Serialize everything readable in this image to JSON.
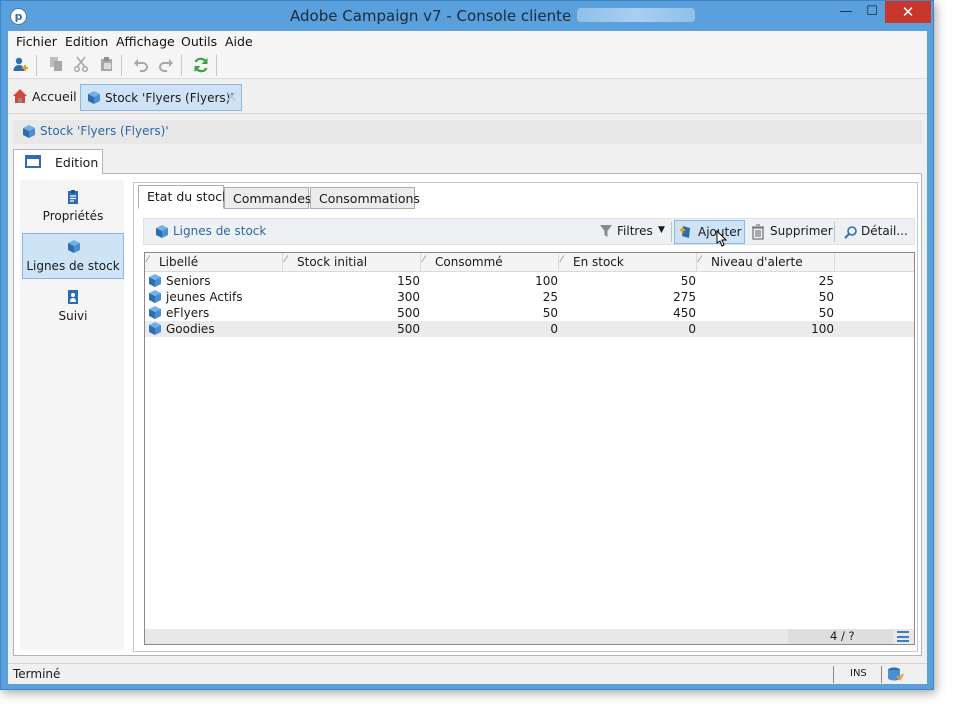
{
  "window": {
    "title": "Adobe Campaign v7 - Console cliente",
    "app_icon_glyph": "p",
    "minimize_glyph": "—",
    "maximize_glyph": "☐",
    "close_glyph": "✕"
  },
  "menu": {
    "items": [
      "Fichier",
      "Edition",
      "Affichage",
      "Outils",
      "Aide"
    ]
  },
  "toolbar": {
    "icons": [
      "add-user-icon",
      "copy-icon",
      "cut-icon",
      "paste-icon",
      "undo-icon",
      "redo-icon",
      "refresh-icon"
    ]
  },
  "tabs": {
    "home_label": "Accueil",
    "doc_label": "Stock 'Flyers (Flyers)'",
    "doc_close": "✕"
  },
  "breadcrumb": {
    "label": "Stock 'Flyers (Flyers)'"
  },
  "edition_tab": {
    "label": "Edition"
  },
  "sidenav": {
    "items": [
      {
        "label": "Propriétés",
        "icon": "clipboard-icon",
        "active": false
      },
      {
        "label": "Lignes de stock",
        "icon": "cubes-icon",
        "active": true
      },
      {
        "label": "Suivi",
        "icon": "tracking-icon",
        "active": false
      }
    ]
  },
  "subtabs": [
    "Etat du stock",
    "Commandes",
    "Consommations"
  ],
  "list_toolbar": {
    "title": "Lignes de stock",
    "filters_label": "Filtres",
    "add_label": "Ajouter",
    "delete_label": "Supprimer",
    "detail_label": "Détail..."
  },
  "grid": {
    "columns": [
      "Libellé",
      "Stock initial",
      "Consommé",
      "En stock",
      "Niveau d'alerte"
    ],
    "sort_glyph": "⁄",
    "rows": [
      [
        "Seniors",
        "150",
        "100",
        "50",
        "25"
      ],
      [
        "jeunes Actifs",
        "300",
        "25",
        "275",
        "50"
      ],
      [
        "eFlyers",
        "500",
        "50",
        "450",
        "50"
      ],
      [
        "Goodies",
        "500",
        "0",
        "0",
        "100"
      ]
    ],
    "count": "4 / ?"
  },
  "status": {
    "text": "Terminé",
    "mode": "INS"
  },
  "colors": {
    "titlebar": "#59a0dc",
    "link_blue": "#2e67a5",
    "selection": "#cfe3f6",
    "close_red": "#c7372c"
  }
}
